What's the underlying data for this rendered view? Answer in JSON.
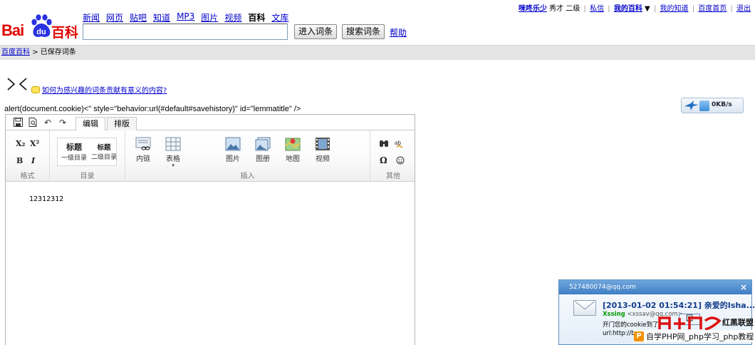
{
  "header": {
    "logo_letters_bai": "Bai",
    "logo_letters_du": "du",
    "logo_product": "百科",
    "channels": [
      "新闻",
      "网页",
      "贴吧",
      "知道",
      "MP3",
      "图片",
      "视频",
      "百科",
      "文库"
    ],
    "current_channel_index": 7,
    "search_value": "",
    "enter_button": "进入词条",
    "search_button": "搜索词条",
    "help_link": "帮助"
  },
  "userbar": {
    "username": "咪咚乐少",
    "rank": "秀才 二级",
    "messages": "私信",
    "my_baike": "我的百科",
    "my_zhidao": "我的知道",
    "baidu_home": "百度首页",
    "logout": "退出"
  },
  "breadcrumb": {
    "root": "百度百科",
    "separator": ">",
    "current": "已保存词条"
  },
  "page": {
    "question_link": "如何为感兴趣的词条贡献有意义的内容?",
    "xss_text": "alert(document.cookie)<\" style=\"behavior:url(#default#savehistory)\" id=\"lemmatitle\" />"
  },
  "speed_widget": {
    "speed": "0KB/s"
  },
  "editor": {
    "tabs": [
      "编辑",
      "排版"
    ],
    "groups": {
      "format": "格式",
      "toc": "目录",
      "insert": "插入",
      "other": "其他"
    },
    "format_buttons": [
      "X₂",
      "X²",
      "B",
      "I"
    ],
    "toc_items": [
      {
        "title": "标题",
        "caption": "一级目录"
      },
      {
        "title": "标题",
        "caption": "二级目录"
      }
    ],
    "insert_items": [
      "内链",
      "表格",
      "图片",
      "图册",
      "地图",
      "视频"
    ],
    "other_buttons": [
      "find",
      "spell",
      "Ω",
      "emoji"
    ],
    "content": "12312312"
  },
  "qq_notification": {
    "account": "527480074@qq.com",
    "close": "×",
    "subject": "[2013-01-02 01:54:21] 亲爱的Isha...",
    "sender_name": "Xssing",
    "sender_email": "<xssav@qq.com>",
    "body_line1": "开门您的cookie到了",
    "body_line2": "url:http://b",
    "reply_button": "回"
  },
  "watermark": {
    "text1": "红黑联盟",
    "text2": "自学PHP网_php学习_php教程",
    "badge": "P"
  },
  "colors": {
    "brand_red": "#e10602",
    "brand_blue": "#2932e1",
    "link": "#0000cc",
    "qq_blue": "#3f7fc4"
  }
}
